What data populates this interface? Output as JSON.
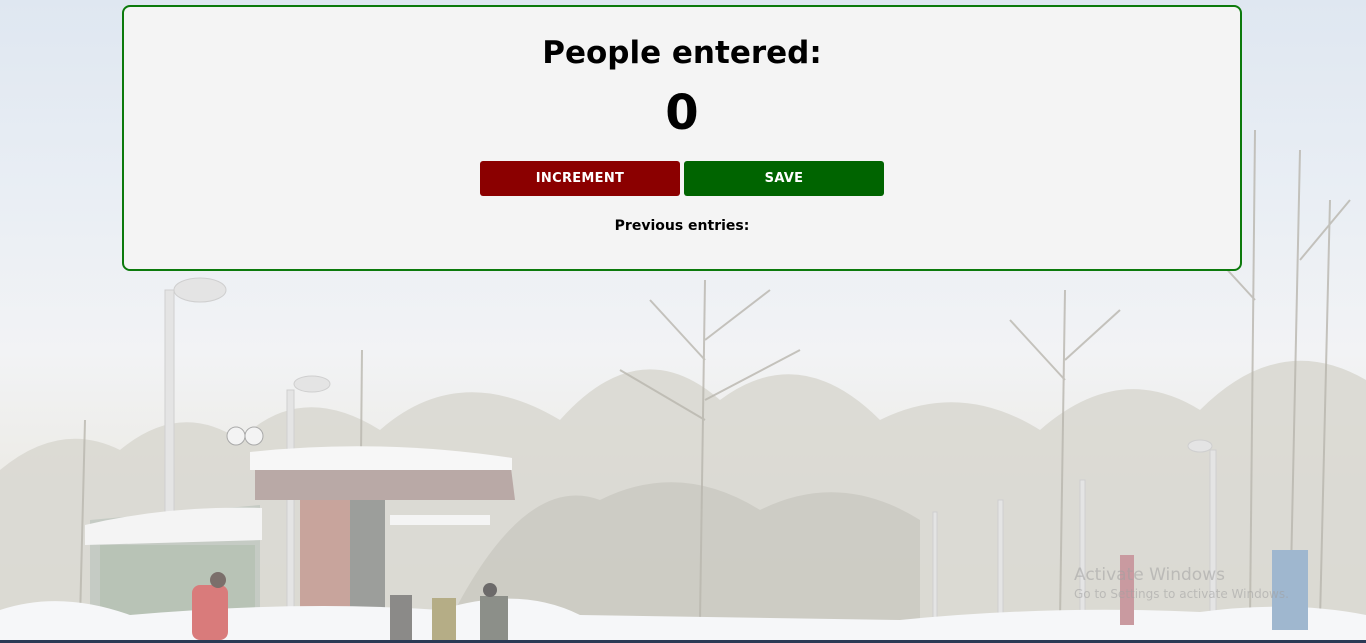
{
  "card": {
    "title": "People entered:",
    "count": "0",
    "increment_label": "INCREMENT",
    "save_label": "SAVE",
    "previous_entries_label": "Previous entries:"
  },
  "watermark": {
    "line1": "Activate Windows",
    "line2": "Go to Settings to activate Windows."
  },
  "colors": {
    "card_border": "#0c7a0c",
    "increment_button": "#8b0000",
    "save_button": "#006400"
  }
}
